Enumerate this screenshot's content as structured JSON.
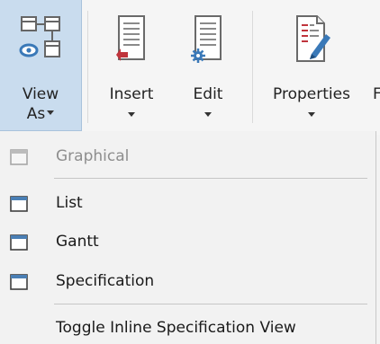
{
  "ribbon": {
    "view_as": {
      "line1": "View",
      "line2": "As",
      "icon": "view-as-icon"
    },
    "insert": {
      "label": "Insert",
      "icon": "insert-document-icon"
    },
    "edit": {
      "label": "Edit",
      "icon": "edit-document-icon"
    },
    "properties": {
      "label": "Properties",
      "icon": "properties-document-icon"
    },
    "cut_off_label": "F"
  },
  "menu": {
    "items": [
      {
        "label": "Graphical",
        "icon": "window-icon",
        "enabled": false
      },
      {
        "label": "List",
        "icon": "window-icon",
        "enabled": true
      },
      {
        "label": "Gantt",
        "icon": "window-icon",
        "enabled": true
      },
      {
        "label": "Specification",
        "icon": "window-icon",
        "enabled": true
      },
      {
        "label": "Toggle Inline Specification View",
        "enabled": true
      }
    ]
  },
  "colors": {
    "pressed_background": "#c9dcee",
    "icon_blue": "#3a79b8",
    "insert_red": "#c0343c",
    "menu_background": "#f2f2f2"
  }
}
